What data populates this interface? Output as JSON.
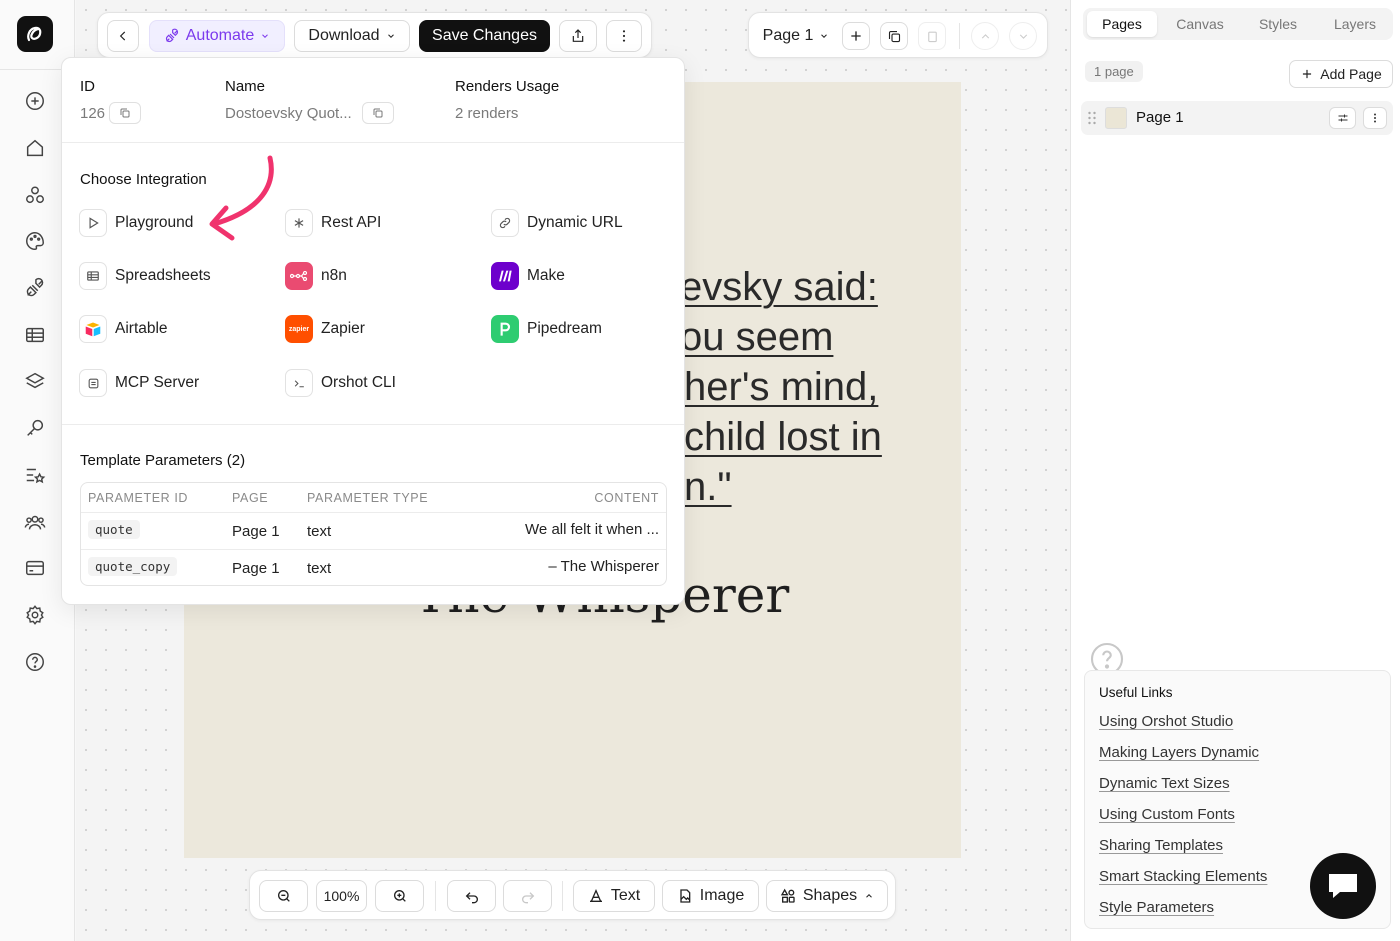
{
  "toolbar": {
    "automate_label": "Automate",
    "download_label": "Download",
    "save_label": "Save Changes",
    "page_select": "Page 1"
  },
  "popover": {
    "id_label": "ID",
    "id_value": "126",
    "name_label": "Name",
    "name_value": "Dostoevsky Quot...",
    "renders_label": "Renders Usage",
    "renders_value": "2 renders",
    "integration_title": "Choose Integration",
    "integrations": [
      {
        "label": "Playground",
        "icon": "play-icon"
      },
      {
        "label": "Rest API",
        "icon": "asterisk-icon"
      },
      {
        "label": "Dynamic URL",
        "icon": "link-icon"
      },
      {
        "label": "Spreadsheets",
        "icon": "table-icon"
      },
      {
        "label": "n8n",
        "icon": "n8n-logo",
        "color": "#ea4b71"
      },
      {
        "label": "Make",
        "icon": "make-logo",
        "color": "#6d00cc"
      },
      {
        "label": "Airtable",
        "icon": "airtable-logo"
      },
      {
        "label": "Zapier",
        "icon": "zapier-logo",
        "color": "#ff4f00",
        "logo_text": "zapier"
      },
      {
        "label": "Pipedream",
        "icon": "pipedream-logo",
        "color": "#2ecc71"
      },
      {
        "label": "MCP Server",
        "icon": "server-icon"
      },
      {
        "label": "Orshot CLI",
        "icon": "terminal-icon"
      }
    ],
    "params_title": "Template Parameters (2)",
    "params_headers": [
      "PARAMETER ID",
      "PAGE",
      "PARAMETER TYPE",
      "CONTENT"
    ],
    "params_rows": [
      {
        "id": "quote",
        "page": "Page 1",
        "type": "text",
        "content": "We all felt it when ..."
      },
      {
        "id": "quote_copy",
        "page": "Page 1",
        "type": "text",
        "content": "– The Whisperer"
      }
    ]
  },
  "artboard": {
    "quote_lines": [
      "evsky said:",
      "ou seem",
      "her's mind,",
      "child lost in",
      "n.\""
    ],
    "author": "The Whisperer"
  },
  "right_panel": {
    "tabs": [
      "Pages",
      "Canvas",
      "Styles",
      "Layers"
    ],
    "active_tab": "Pages",
    "page_count": "1 page",
    "add_page_label": "Add Page",
    "pages": [
      "Page 1"
    ],
    "useful_links_title": "Useful Links",
    "useful_links": [
      "Using Orshot Studio",
      "Making Layers Dynamic",
      "Dynamic Text Sizes",
      "Using Custom Fonts",
      "Sharing Templates",
      "Smart Stacking Elements",
      "Style Parameters"
    ]
  },
  "bottom_bar": {
    "zoom": "100%",
    "text_label": "Text",
    "image_label": "Image",
    "shapes_label": "Shapes"
  },
  "colors": {
    "accent": "#7c3aed",
    "arrow": "#f0336d",
    "artboard_bg": "#ece8dc"
  }
}
